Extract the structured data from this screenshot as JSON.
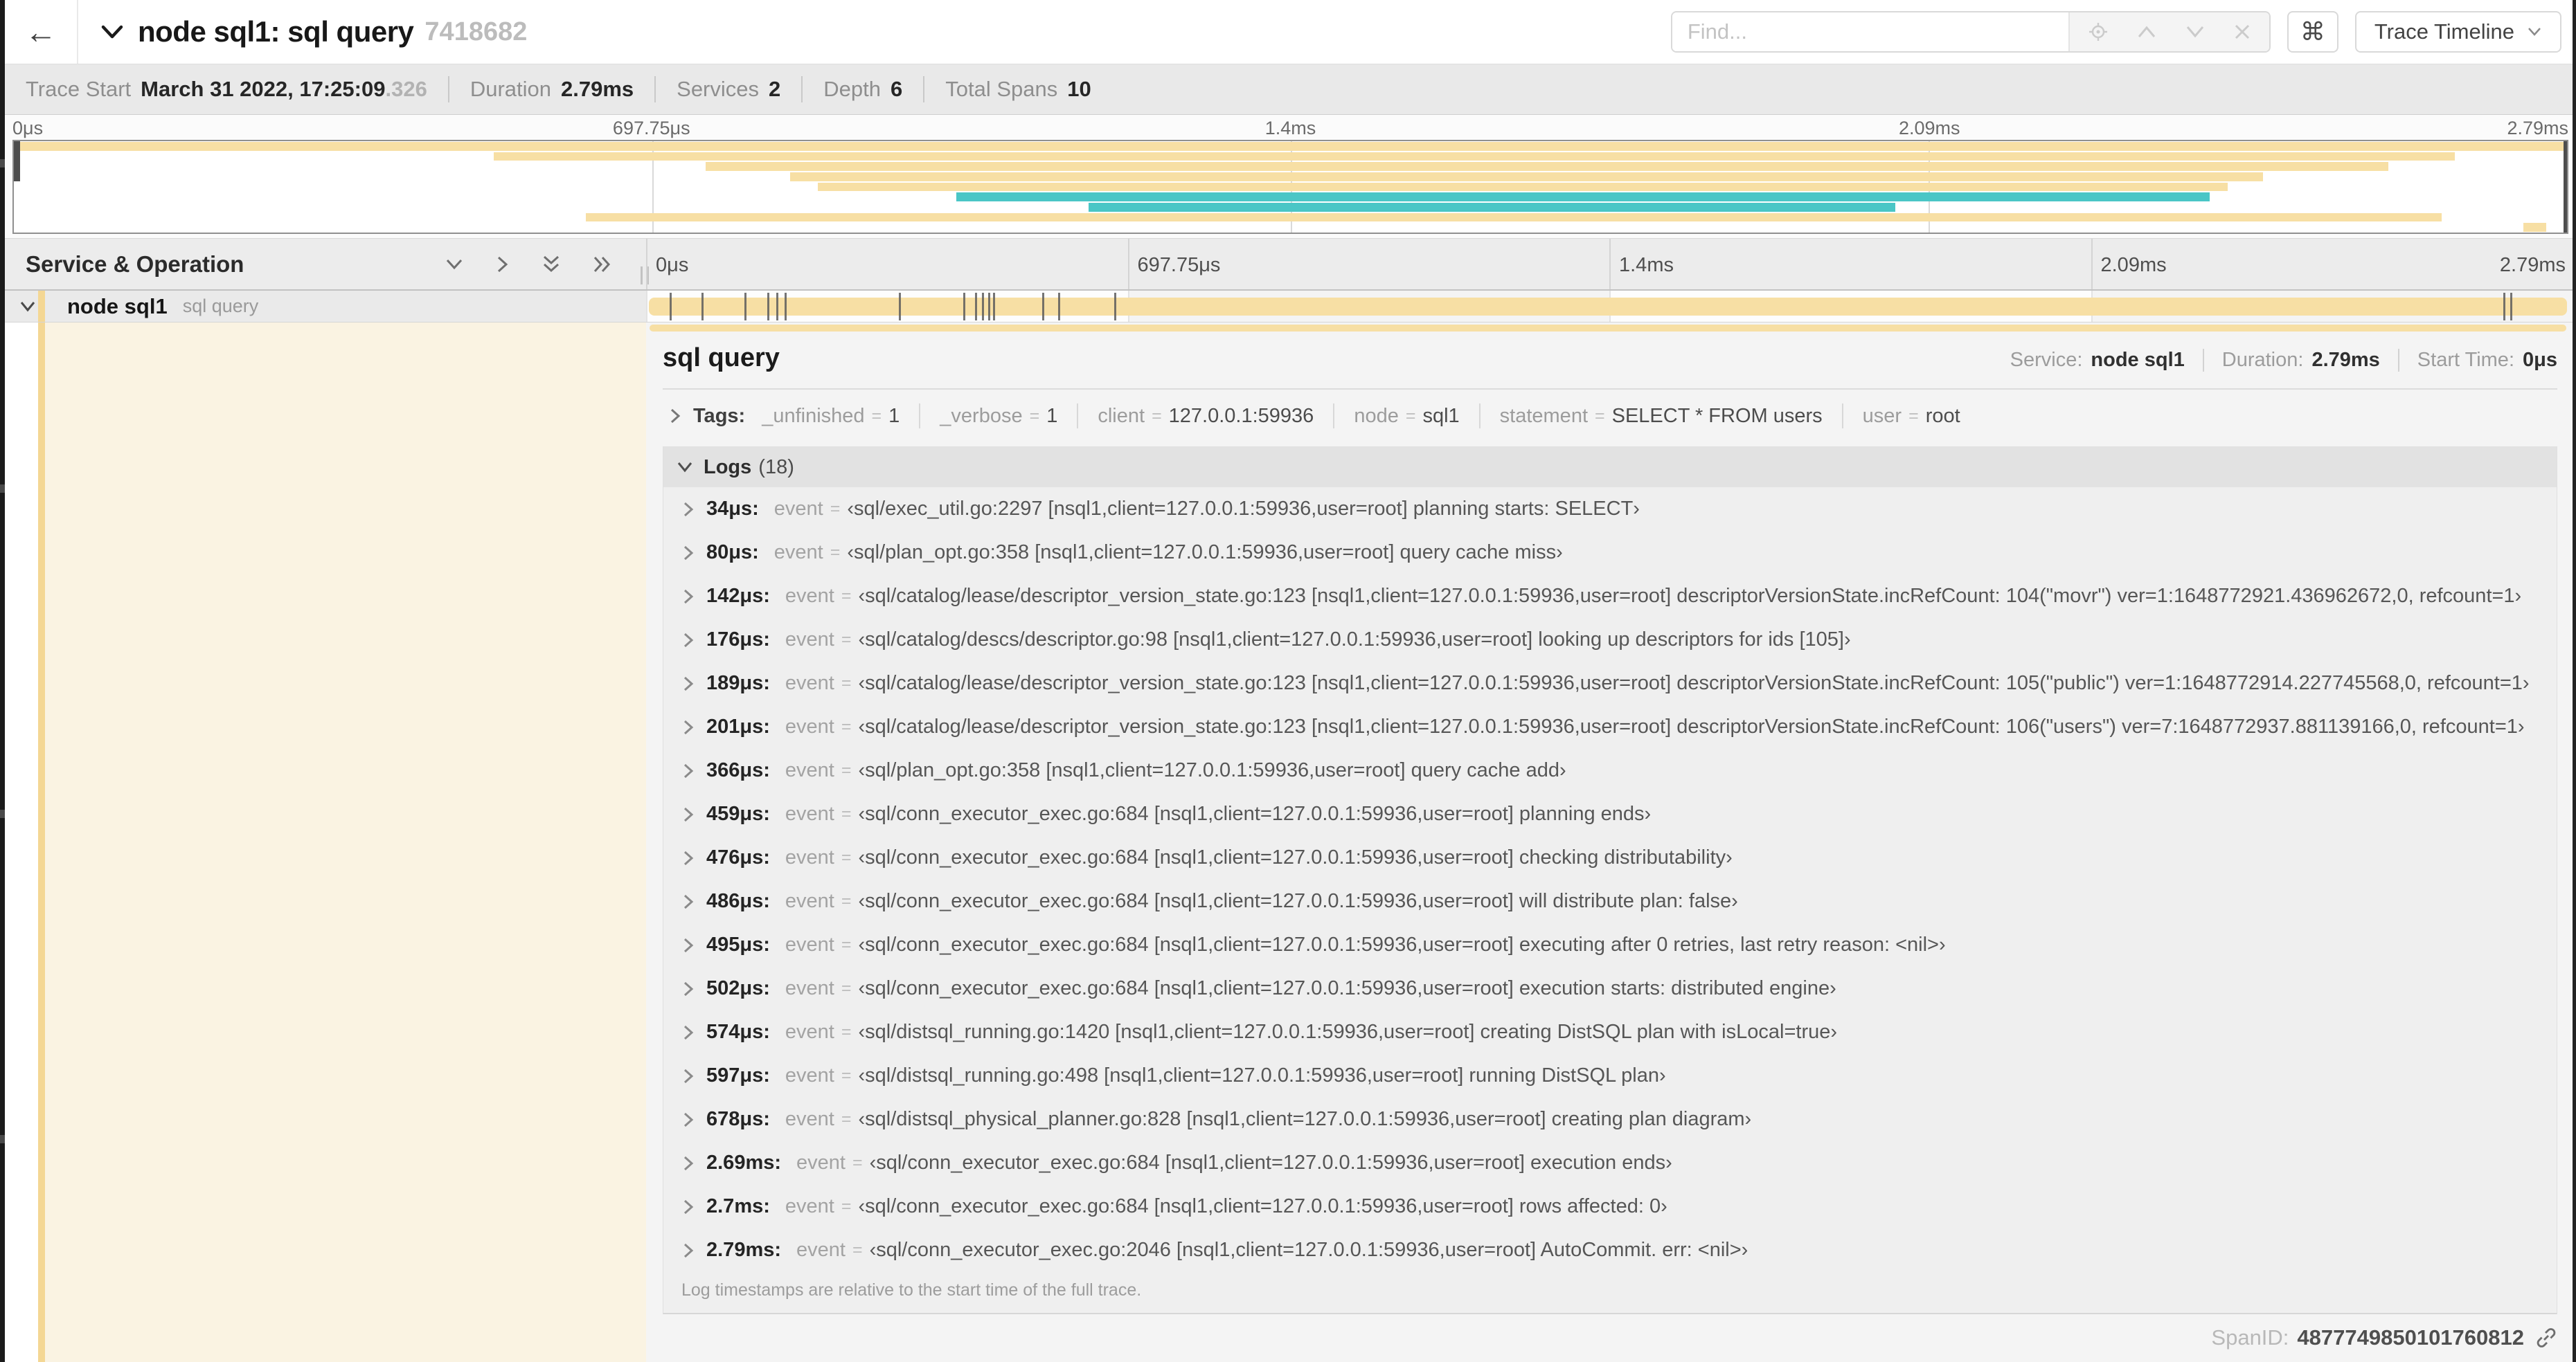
{
  "colors": {
    "tan": "#f7dfa4",
    "teal": "#4ac6c6",
    "cream": "#faf3e2",
    "accent": "#f4d794"
  },
  "topbar": {
    "back": "←",
    "title": "node sql1: sql query",
    "trace_id": "7418682",
    "find_placeholder": "Find...",
    "shortcut": "⌘",
    "view_label": "Trace Timeline"
  },
  "stats": {
    "items": [
      {
        "label": "Trace Start",
        "value": "March 31 2022, 17:25:09",
        "muted": ".326"
      },
      {
        "label": "Duration",
        "value": "2.79ms"
      },
      {
        "label": "Services",
        "value": "2"
      },
      {
        "label": "Depth",
        "value": "6"
      },
      {
        "label": "Total Spans",
        "value": "10"
      }
    ]
  },
  "minimap": {
    "ticks": [
      "0μs",
      "697.75μs",
      "1.4ms",
      "2.09ms",
      "2.79ms"
    ],
    "spans": [
      {
        "start": 0,
        "end": 100,
        "color": "tan"
      },
      {
        "start": 18.8,
        "end": 95.6,
        "color": "tan"
      },
      {
        "start": 27.1,
        "end": 93.0,
        "color": "tan"
      },
      {
        "start": 30.4,
        "end": 88.1,
        "color": "tan"
      },
      {
        "start": 31.5,
        "end": 86.7,
        "color": "tan"
      },
      {
        "start": 36.9,
        "end": 86.0,
        "color": "teal"
      },
      {
        "start": 42.1,
        "end": 73.7,
        "color": "teal"
      },
      {
        "start": 22.4,
        "end": 95.1,
        "color": "tan"
      },
      {
        "start": 98.3,
        "end": 99.2,
        "color": "tan"
      }
    ]
  },
  "timeline": {
    "left_header": "Service & Operation",
    "ticks": [
      "0μs",
      "697.75μs",
      "1.4ms",
      "2.09ms",
      "2.79ms"
    ],
    "row": {
      "service": "node sql1",
      "operation": "sql query"
    },
    "duration_us": 2790,
    "marks_us": [
      34,
      80,
      142,
      176,
      189,
      201,
      366,
      459,
      476,
      486,
      495,
      502,
      574,
      597,
      678,
      2690,
      2700
    ]
  },
  "detail": {
    "title": "sql query",
    "meta": [
      {
        "label": "Service:",
        "value": "node sql1"
      },
      {
        "label": "Duration:",
        "value": "2.79ms"
      },
      {
        "label": "Start Time:",
        "value": "0μs"
      }
    ],
    "tags_label": "Tags:",
    "eq": "=",
    "tags": [
      {
        "key": "_unfinished",
        "value": "1"
      },
      {
        "key": "_verbose",
        "value": "1"
      },
      {
        "key": "client",
        "value": "127.0.0.1:59936"
      },
      {
        "key": "node",
        "value": "sql1"
      },
      {
        "key": "statement",
        "value": "SELECT * FROM users"
      },
      {
        "key": "user",
        "value": "root"
      }
    ],
    "logs": {
      "label": "Logs",
      "count": "(18)",
      "key_label": "event",
      "rows": [
        {
          "t": "34μs:",
          "msg": "‹sql/exec_util.go:2297 [nsql1,client=127.0.0.1:59936,user=root] planning starts: SELECT›"
        },
        {
          "t": "80μs:",
          "msg": "‹sql/plan_opt.go:358 [nsql1,client=127.0.0.1:59936,user=root] query cache miss›"
        },
        {
          "t": "142μs:",
          "msg": "‹sql/catalog/lease/descriptor_version_state.go:123 [nsql1,client=127.0.0.1:59936,user=root] descriptorVersionState.incRefCount: 104(\"movr\") ver=1:1648772921.436962672,0, refcount=1›"
        },
        {
          "t": "176μs:",
          "msg": "‹sql/catalog/descs/descriptor.go:98 [nsql1,client=127.0.0.1:59936,user=root] looking up descriptors for ids [105]›"
        },
        {
          "t": "189μs:",
          "msg": "‹sql/catalog/lease/descriptor_version_state.go:123 [nsql1,client=127.0.0.1:59936,user=root] descriptorVersionState.incRefCount: 105(\"public\") ver=1:1648772914.227745568,0, refcount=1›"
        },
        {
          "t": "201μs:",
          "msg": "‹sql/catalog/lease/descriptor_version_state.go:123 [nsql1,client=127.0.0.1:59936,user=root] descriptorVersionState.incRefCount: 106(\"users\") ver=7:1648772937.881139166,0, refcount=1›"
        },
        {
          "t": "366μs:",
          "msg": "‹sql/plan_opt.go:358 [nsql1,client=127.0.0.1:59936,user=root] query cache add›"
        },
        {
          "t": "459μs:",
          "msg": "‹sql/conn_executor_exec.go:684 [nsql1,client=127.0.0.1:59936,user=root] planning ends›"
        },
        {
          "t": "476μs:",
          "msg": "‹sql/conn_executor_exec.go:684 [nsql1,client=127.0.0.1:59936,user=root] checking distributability›"
        },
        {
          "t": "486μs:",
          "msg": "‹sql/conn_executor_exec.go:684 [nsql1,client=127.0.0.1:59936,user=root] will distribute plan: false›"
        },
        {
          "t": "495μs:",
          "msg": "‹sql/conn_executor_exec.go:684 [nsql1,client=127.0.0.1:59936,user=root] executing after 0 retries, last retry reason: <nil>›"
        },
        {
          "t": "502μs:",
          "msg": "‹sql/conn_executor_exec.go:684 [nsql1,client=127.0.0.1:59936,user=root] execution starts: distributed engine›"
        },
        {
          "t": "574μs:",
          "msg": "‹sql/distsql_running.go:1420 [nsql1,client=127.0.0.1:59936,user=root] creating DistSQL plan with isLocal=true›"
        },
        {
          "t": "597μs:",
          "msg": "‹sql/distsql_running.go:498 [nsql1,client=127.0.0.1:59936,user=root] running DistSQL plan›"
        },
        {
          "t": "678μs:",
          "msg": "‹sql/distsql_physical_planner.go:828 [nsql1,client=127.0.0.1:59936,user=root] creating plan diagram›"
        },
        {
          "t": "2.69ms:",
          "msg": "‹sql/conn_executor_exec.go:684 [nsql1,client=127.0.0.1:59936,user=root] execution ends›"
        },
        {
          "t": "2.7ms:",
          "msg": "‹sql/conn_executor_exec.go:684 [nsql1,client=127.0.0.1:59936,user=root] rows affected: 0›"
        },
        {
          "t": "2.79ms:",
          "msg": "‹sql/conn_executor_exec.go:2046 [nsql1,client=127.0.0.1:59936,user=root] AutoCommit. err: <nil>›"
        }
      ],
      "note": "Log timestamps are relative to the start time of the full trace."
    },
    "span_id_label": "SpanID:",
    "span_id": "4877749850101760812"
  }
}
